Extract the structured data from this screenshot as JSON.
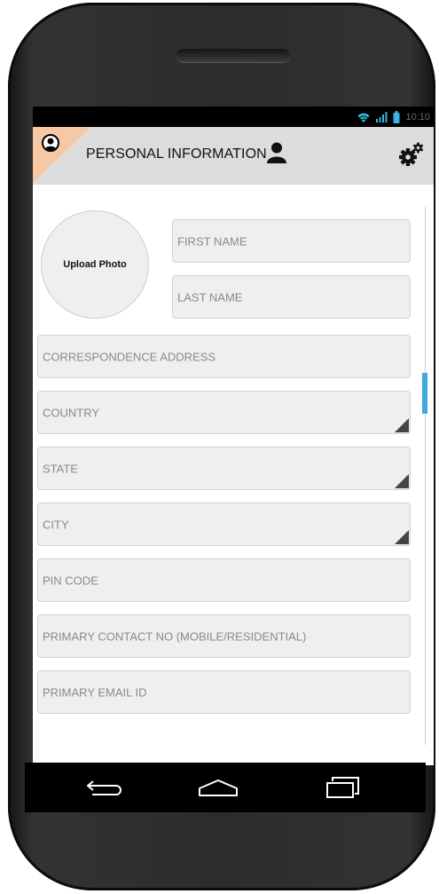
{
  "status_bar": {
    "time": "10:10",
    "icons": [
      "wifi-icon",
      "signal-icon",
      "battery-icon"
    ]
  },
  "app_bar": {
    "title": "PERSONAL INFORMATION",
    "icons": [
      "profile-avatar-icon",
      "person-icon",
      "settings-gears-icon"
    ]
  },
  "photo": {
    "label": "Upload Photo"
  },
  "form": {
    "first_name": {
      "placeholder": "FIRST NAME"
    },
    "last_name": {
      "placeholder": "LAST NAME"
    },
    "address": {
      "placeholder": "CORRESPONDENCE ADDRESS"
    },
    "country": {
      "placeholder": "COUNTRY"
    },
    "state": {
      "placeholder": "STATE"
    },
    "city": {
      "placeholder": "CITY"
    },
    "pin_code": {
      "placeholder": "PIN CODE"
    },
    "contact": {
      "placeholder": "PRIMARY CONTACT NO (MOBILE/RESIDENTIAL)"
    },
    "email": {
      "placeholder": "PRIMARY EMAIL ID"
    }
  },
  "nav_bar": {
    "icons": [
      "back-icon",
      "home-icon",
      "recent-apps-icon"
    ]
  },
  "colors": {
    "accent": "#3fa9dc",
    "corner": "#f7c8a4",
    "app_bar": "#dcdcdc",
    "field_bg": "#efefef",
    "placeholder": "#8a8a8a"
  }
}
